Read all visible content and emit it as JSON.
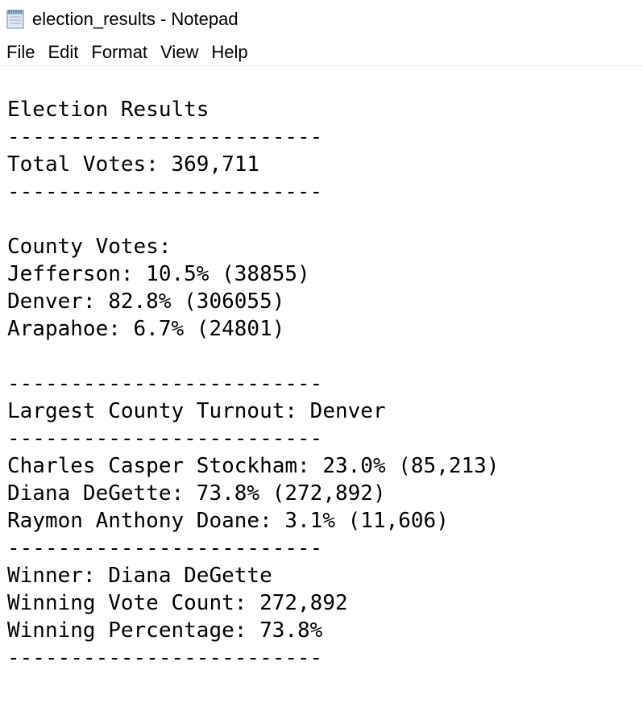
{
  "window": {
    "title": "election_results - Notepad",
    "icon": "notepad-icon"
  },
  "menu": {
    "items": [
      "File",
      "Edit",
      "Format",
      "View",
      "Help"
    ]
  },
  "document": {
    "lines": [
      "Election Results",
      "-------------------------",
      "Total Votes: 369,711",
      "-------------------------",
      "",
      "County Votes:",
      "Jefferson: 10.5% (38855)",
      "Denver: 82.8% (306055)",
      "Arapahoe: 6.7% (24801)",
      "",
      "-------------------------",
      "Largest County Turnout: Denver",
      "-------------------------",
      "Charles Casper Stockham: 23.0% (85,213)",
      "Diana DeGette: 73.8% (272,892)",
      "Raymon Anthony Doane: 3.1% (11,606)",
      "-------------------------",
      "Winner: Diana DeGette",
      "Winning Vote Count: 272,892",
      "Winning Percentage: 73.8%",
      "-------------------------"
    ]
  }
}
